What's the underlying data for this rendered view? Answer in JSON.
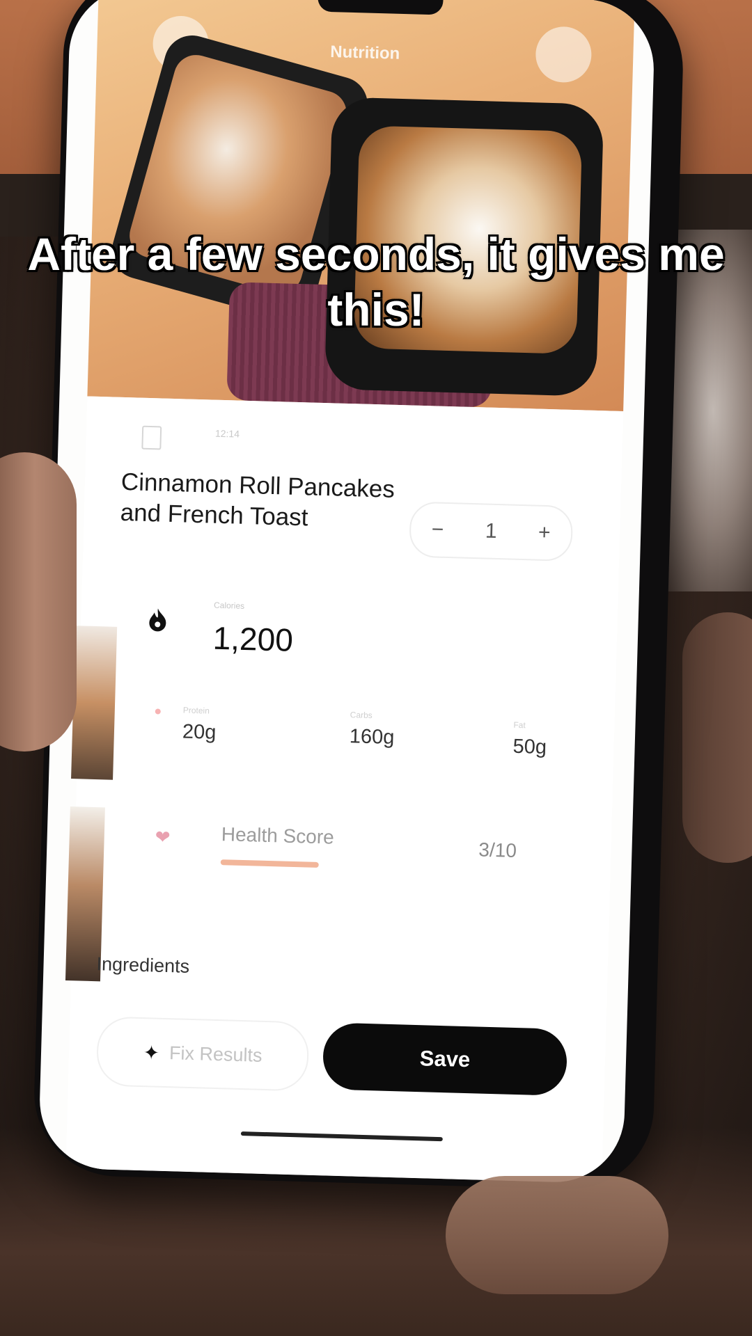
{
  "caption": "After a few seconds, it gives me this!",
  "photo": {
    "header": "Nutrition"
  },
  "meal": {
    "time": "12:14",
    "title": "Cinnamon Roll Pancakes and French Toast",
    "quantity": "1",
    "decrement_symbol": "−",
    "increment_symbol": "+"
  },
  "calories": {
    "label": "Calories",
    "value": "1,200",
    "icon": "flame-icon"
  },
  "macros": [
    {
      "label": "Protein",
      "value": "20g"
    },
    {
      "label": "Carbs",
      "value": "160g"
    },
    {
      "label": "Fat",
      "value": "50g"
    }
  ],
  "health_score": {
    "label": "Health Score",
    "value": "3/10",
    "level": 0.3,
    "icon": "heart-icon",
    "color": "#f2b69a"
  },
  "ingredients": {
    "label": "Ingredients"
  },
  "actions": {
    "fix_label": "Fix Results",
    "save_label": "Save"
  },
  "colors": {
    "save_button": "#0b0b0b",
    "sheet": "#ffffff"
  }
}
